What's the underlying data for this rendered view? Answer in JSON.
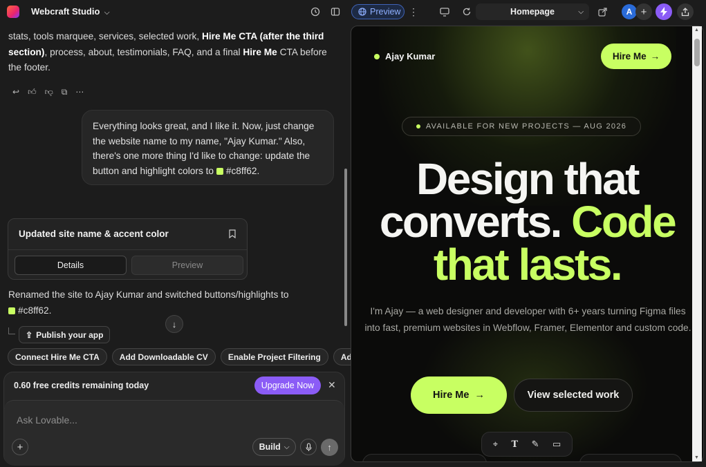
{
  "topbar": {
    "project_name": "Webcraft Studio",
    "preview_label": "Preview",
    "page_select": "Homepage",
    "avatar_initial": "A"
  },
  "chat": {
    "prev_message_lead": "stats, tools marquee, services, selected work, ",
    "prev_message_bold1": "Hire Me CTA (after the third section)",
    "prev_message_mid": ", process, about, testimonials, FAQ, and a final ",
    "prev_message_bold2": "Hire Me",
    "prev_message_tail": " CTA before the footer.",
    "user_message": "Everything looks great, and I like it. Now, just change the website name to my name, \"Ajay Kumar.\" Also, there's one more thing I'd like to change: update the button and highlight colors to",
    "user_color": "#c8ff62.",
    "card_title": "Updated site name & accent color",
    "card_tab_details": "Details",
    "card_tab_preview": "Preview",
    "reply_text": "Renamed the site to Ajay Kumar and switched buttons/highlights to",
    "reply_color": "#c8ff62.",
    "publish_label": "Publish your app",
    "suggestions": [
      "Connect Hire Me CTA",
      "Add Downloadable CV",
      "Enable Project Filtering",
      "Add"
    ]
  },
  "composer": {
    "credits_text": "0.60 free credits remaining today",
    "upgrade_label": "Upgrade Now",
    "placeholder": "Ask Lovable...",
    "mode_label": "Build"
  },
  "site": {
    "brand": "Ajay Kumar",
    "hire_top": "Hire Me",
    "availability": "AVAILABLE FOR NEW PROJECTS — AUG 2026",
    "headline_1": "Design that",
    "headline_2": "converts.",
    "headline_3": "Code",
    "headline_4": "that lasts.",
    "subtitle": "I'm Ajay — a web designer and developer with 6+ years turning Figma files into fast, premium websites in Webflow, Framer, Elementor and custom code.",
    "hire_main": "Hire Me",
    "view_work": "View selected work",
    "accent_color": "#c8ff62"
  },
  "icons": {
    "arrow": "→",
    "history": "history-icon",
    "sidebar": "sidebar-toggle-icon",
    "monitor": "monitor-icon",
    "refresh": "refresh-icon",
    "external": "external-link-icon",
    "share": "share-icon"
  }
}
